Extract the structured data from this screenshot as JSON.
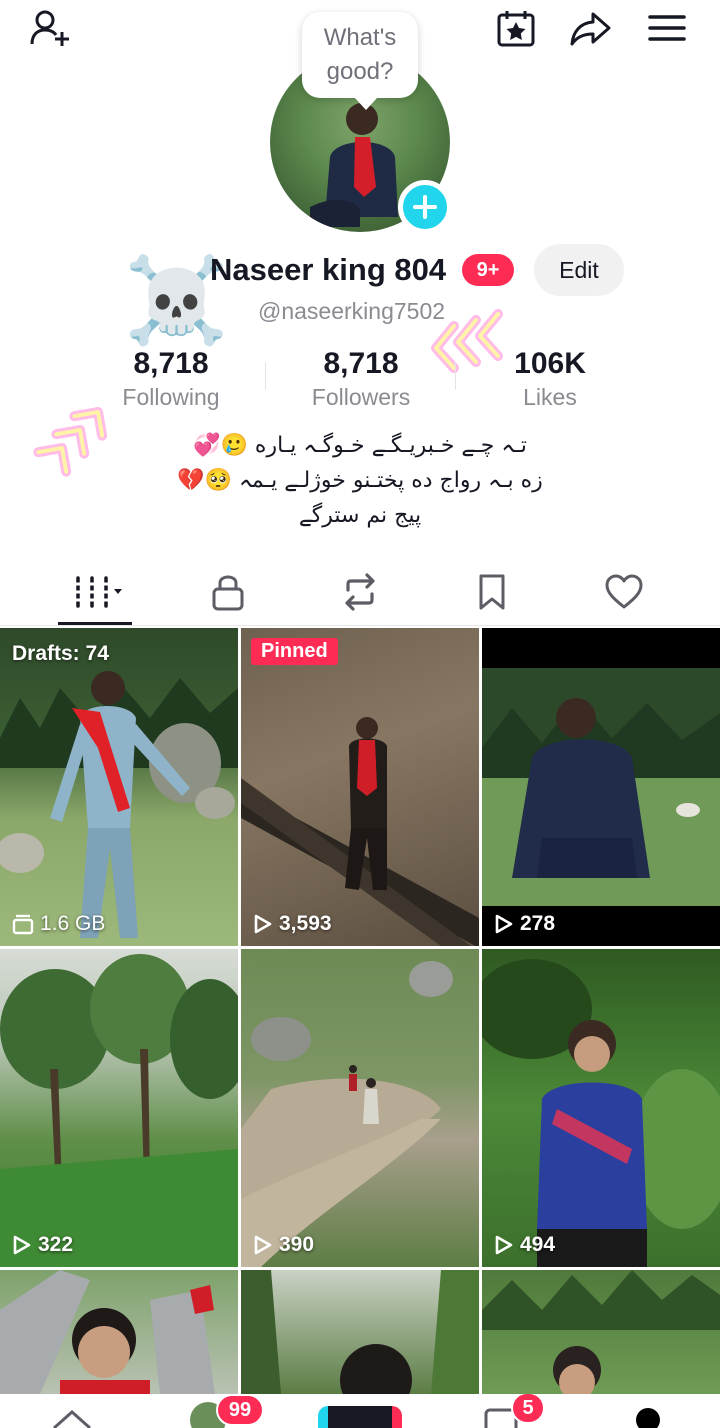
{
  "topbar": {
    "icons": [
      "add-user-icon",
      "calendar-star-icon",
      "share-icon",
      "menu-icon"
    ]
  },
  "profile": {
    "status_bubble": "What's good?",
    "name": "Naseer king 804",
    "notification_badge": "9+",
    "edit_label": "Edit",
    "handle": "@naseerking7502",
    "decor_emoji": "☠️"
  },
  "stats": {
    "following_value": "8,718",
    "following_label": "Following",
    "followers_value": "8,718",
    "followers_label": "Followers",
    "likes_value": "106K",
    "likes_label": "Likes"
  },
  "bio": {
    "line1": "تـہ چـے خـبریـگـے خـوگـہ یـاره 🥲💞",
    "line2": "زه بـہ رواج ده پختـنو خوژلـے یـمہ 🥺💔",
    "line3": "پیج نم سترگے"
  },
  "tabs": [
    "videos-grid-tab",
    "private-tab",
    "reposts-tab",
    "favorites-tab",
    "liked-tab"
  ],
  "grid": {
    "items": [
      {
        "top_label": "Drafts: 74",
        "bottom_label": "1.6 GB"
      },
      {
        "top_label": "Pinned",
        "bottom_label": "3,593"
      },
      {
        "bottom_label": "278"
      },
      {
        "bottom_label": "322"
      },
      {
        "bottom_label": "390"
      },
      {
        "bottom_label": "494"
      }
    ]
  },
  "bottom_nav": {
    "friends_badge": "99",
    "inbox_badge": "5"
  },
  "colors": {
    "accent_red": "#fe2c55",
    "accent_cyan": "#20d5ec",
    "text_primary": "#161823",
    "text_secondary": "#8a8b91",
    "neon_pink": "#ff8fd8",
    "neon_yellow": "#fff3a8"
  }
}
